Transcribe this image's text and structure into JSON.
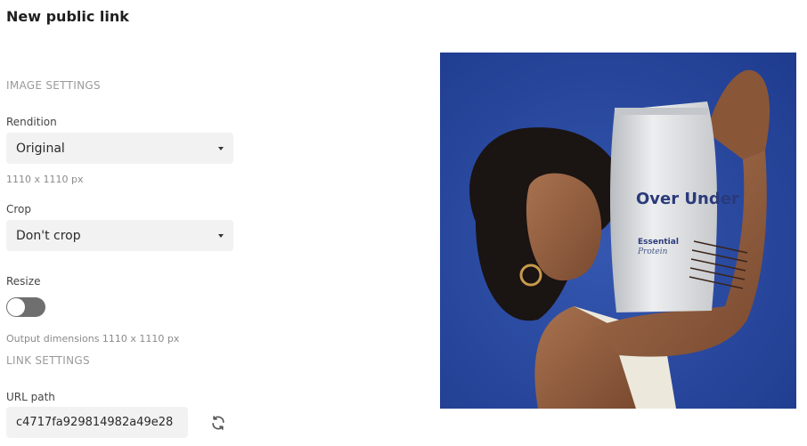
{
  "page": {
    "title": "New public link"
  },
  "image_settings": {
    "heading": "IMAGE SETTINGS",
    "rendition": {
      "label": "Rendition",
      "value": "Original",
      "dimensions": "1110 x 1110 px"
    },
    "crop": {
      "label": "Crop",
      "value": "Don't crop"
    },
    "resize": {
      "label": "Resize",
      "enabled": false,
      "output": "Output dimensions 1110 x 1110 px"
    }
  },
  "link_settings": {
    "heading": "LINK SETTINGS",
    "url_path": {
      "label": "URL path",
      "value": "c4717fa929814982a49e28"
    }
  },
  "preview": {
    "product_brand": "Over Under",
    "product_line1": "Essential",
    "product_line2": "Protein",
    "colors": {
      "background": "#2a4aa0",
      "pouch": "#d9dbdd"
    }
  },
  "icons": {
    "refresh": "refresh-icon",
    "caret": "chevron-down-icon"
  }
}
